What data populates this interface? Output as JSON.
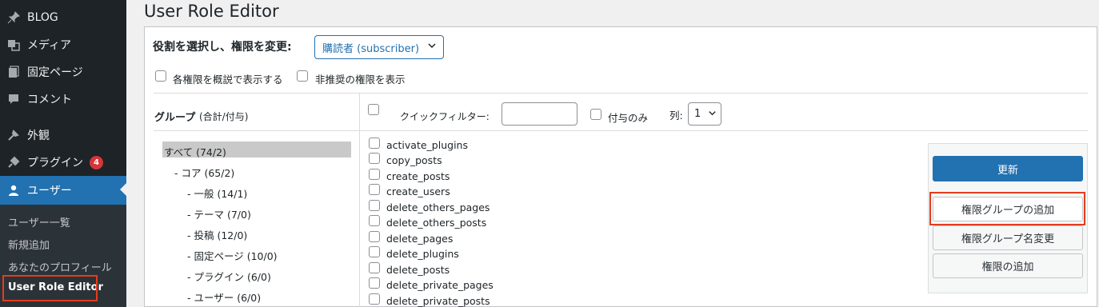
{
  "sidebar": {
    "items": [
      {
        "label": "BLOG",
        "icon": "pushpin-icon"
      },
      {
        "label": "メディア",
        "icon": "media-icon"
      },
      {
        "label": "固定ページ",
        "icon": "pages-icon"
      },
      {
        "label": "コメント",
        "icon": "comment-icon"
      },
      {
        "label": "外観",
        "icon": "appearance-icon"
      },
      {
        "label": "プラグイン",
        "icon": "plugin-icon",
        "badge": "4"
      },
      {
        "label": "ユーザー",
        "icon": "user-icon"
      }
    ],
    "submenu": [
      "ユーザー一覧",
      "新規追加",
      "あなたのプロフィール",
      "User Role Editor"
    ]
  },
  "page": {
    "title": "User Role Editor"
  },
  "role_select": {
    "label": "役割を選択し、権限を変更:",
    "value": "購読者 (subscriber)"
  },
  "options": {
    "human_readable": "各権限を概説で表示する",
    "deprecated": "非推奨の権限を表示"
  },
  "groups": {
    "header_main": "グループ",
    "header_sub": "(合計/付与)",
    "items": [
      "すべて (74/2)",
      "- コア (65/2)",
      "- 一般 (14/1)",
      "- テーマ (7/0)",
      "- 投稿 (12/0)",
      "- 固定ページ (10/0)",
      "- プラグイン (6/0)",
      "- ユーザー (6/0)"
    ]
  },
  "filter": {
    "quick_label": "クイックフィルター:",
    "quick_value": "",
    "granted_only": "付与のみ",
    "columns_label": "列:",
    "columns_value": "1"
  },
  "capabilities": [
    "activate_plugins",
    "copy_posts",
    "create_posts",
    "create_users",
    "delete_others_pages",
    "delete_others_posts",
    "delete_pages",
    "delete_plugins",
    "delete_posts",
    "delete_private_pages",
    "delete_private_posts"
  ],
  "actions": {
    "update": "更新",
    "add_group": "権限グループの追加",
    "rename_group": "権限グループ名変更",
    "add_cap": "権限の追加"
  },
  "colors": {
    "sidebar": "#1d2327",
    "accent": "#2271b1",
    "highlight": "#e33d1e",
    "badge": "#d63638"
  }
}
